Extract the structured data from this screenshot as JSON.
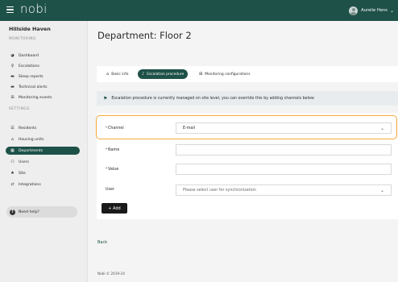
{
  "topbar": {
    "logo": "nobi",
    "user_name": "Aurelie Hens"
  },
  "sidebar": {
    "site_name": "Hillside Haven",
    "monitoring_label": "MONITORING",
    "monitoring_items": [
      {
        "label": "Dashboard",
        "icon": "palette-icon"
      },
      {
        "label": "Escalations",
        "icon": "pin-icon"
      },
      {
        "label": "Sleep reports",
        "icon": "bed-icon"
      },
      {
        "label": "Technical alerts",
        "icon": "bed-alert-icon"
      },
      {
        "label": "Monitoring events",
        "icon": "monitor-icon"
      }
    ],
    "settings_label": "SETTINGS",
    "settings_items": [
      {
        "label": "Residents",
        "icon": "residents-icon"
      },
      {
        "label": "Housing units",
        "icon": "home-icon"
      },
      {
        "label": "Departments",
        "icon": "building-icon",
        "active": true
      },
      {
        "label": "Users",
        "icon": "users-icon"
      },
      {
        "label": "Site",
        "icon": "site-icon"
      },
      {
        "label": "Integrations",
        "icon": "arrows-icon"
      }
    ],
    "help_label": "Need help?"
  },
  "main": {
    "title": "Department: Floor 2",
    "tabs": [
      {
        "label": "Basic info",
        "icon": "home-icon"
      },
      {
        "label": "Escalation procedure",
        "icon": "bell-icon",
        "active": true
      },
      {
        "label": "Monitoring configurations",
        "icon": "monitor-icon"
      }
    ],
    "notice": "Escalation procedure is currently managed on site level, you can override this by adding channels below",
    "form": {
      "required_marker": "*",
      "channel": {
        "label": "Channel",
        "value": "E-mail"
      },
      "name": {
        "label": "Name",
        "value": ""
      },
      "value": {
        "label": "Value",
        "value": ""
      },
      "user": {
        "label": "User",
        "placeholder": "Please select user for synchronization"
      },
      "add_label": "+ Add"
    },
    "back_label": "Back",
    "footer": "Nobi © 2019-24"
  },
  "colors": {
    "brand": "#1e5148",
    "highlight": "#f2a93b"
  }
}
